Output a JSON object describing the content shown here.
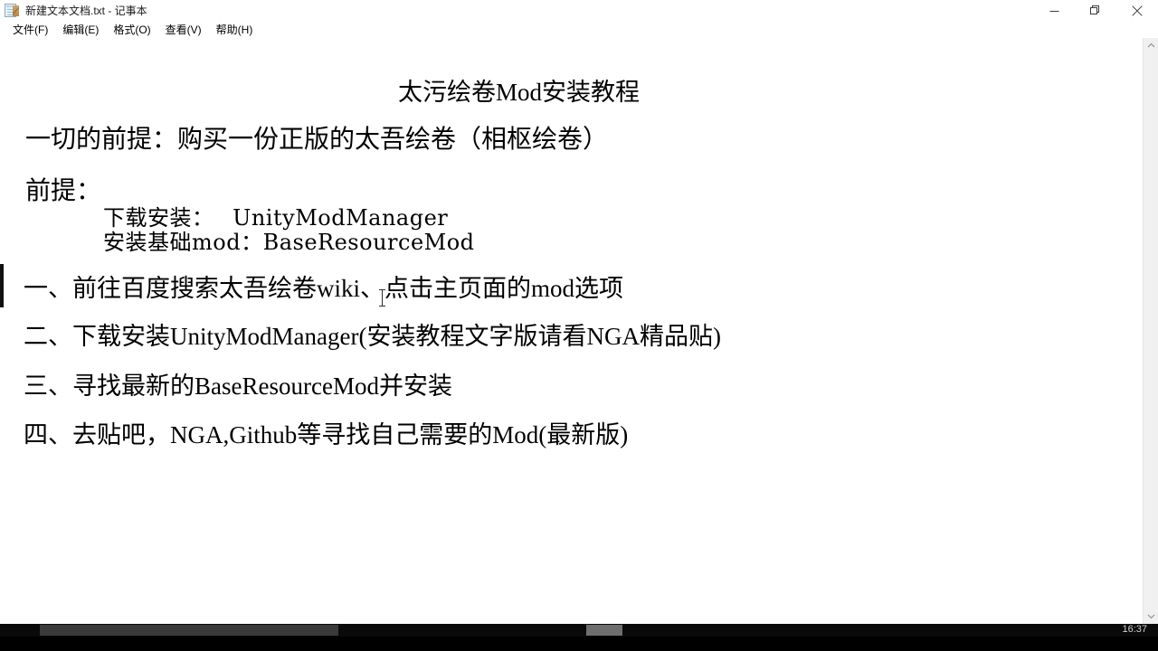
{
  "window": {
    "title": "新建文本文档.txt - 记事本",
    "icon": "notepad-document-icon",
    "controls": {
      "minimize": "minimize-icon",
      "restore": "restore-icon",
      "close": "close-icon"
    }
  },
  "menu": {
    "items": [
      {
        "label": "文件(F)"
      },
      {
        "label": "编辑(E)"
      },
      {
        "label": "格式(O)"
      },
      {
        "label": "查看(V)"
      },
      {
        "label": "帮助(H)"
      }
    ]
  },
  "document": {
    "title": "太污绘卷Mod安装教程",
    "premise": "一切的前提：购买一份正版的太吾绘卷（相枢绘卷）",
    "prereq_heading": "前提：",
    "prereq_line_1": "下载安装：　 UnityModManager",
    "prereq_line_2": "安装基础mod：BaseResourceMod",
    "step_1": "一、前往百度搜索太吾绘卷wiki、点击主页面的mod选项",
    "step_2": "二、下载安装UnityModManager(安装教程文字版请看NGA精品贴)",
    "step_3": "三、寻找最新的BaseResourceMod并安装",
    "step_4": "四、去贴吧，NGA,Github等寻找自己需要的Mod(最新版)"
  },
  "scrollbar": {
    "up_arrow": "chevron-up-icon",
    "down_arrow": "chevron-down-icon"
  },
  "taskbar": {
    "clock": "16:37"
  },
  "colors": {
    "window_background": "#ffffff",
    "text": "#000000",
    "titlebar": "#ffffff",
    "scrollbar_track": "#f0f0f0",
    "taskbar": "#000000"
  }
}
